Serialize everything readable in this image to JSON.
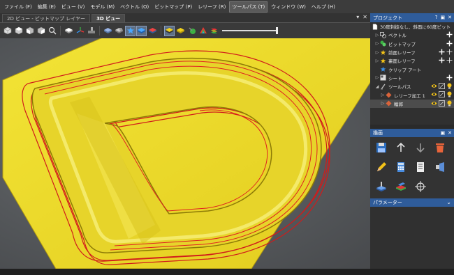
{
  "menu": [
    {
      "label": "ファイル (F)",
      "active": false
    },
    {
      "label": "編集 (E)",
      "active": false
    },
    {
      "label": "ビュー (V)",
      "active": false
    },
    {
      "label": "モデル (M)",
      "active": false
    },
    {
      "label": "ベクトル (O)",
      "active": false
    },
    {
      "label": "ビットマップ (P)",
      "active": false
    },
    {
      "label": "レリーフ (R)",
      "active": false
    },
    {
      "label": "ツールパス (T)",
      "active": true
    },
    {
      "label": "ウィンドウ (W)",
      "active": false
    },
    {
      "label": "ヘルプ (H)",
      "active": false
    }
  ],
  "tabs": [
    {
      "label": "2D ビュー - ビットマップ レイヤー",
      "active": false
    },
    {
      "label": "3D ビュー",
      "active": true
    }
  ],
  "tab_controls": {
    "pin": "▾",
    "close": "✕"
  },
  "project_panel": {
    "title": "プロジェクト",
    "controls": [
      "?",
      "▣",
      "✕"
    ],
    "tree": [
      {
        "label": "30度刺抜なし、斜面に60度ビット",
        "indent": 0,
        "arrow": "",
        "icon": "doc-icon",
        "highlight": false
      },
      {
        "label": "ベクトル",
        "indent": 1,
        "arrow": "▷",
        "icon": "vector-icon",
        "highlight": false
      },
      {
        "label": "ビットマップ",
        "indent": 1,
        "arrow": "▷",
        "icon": "bitmap-icon",
        "highlight": false
      },
      {
        "label": "前面レリーフ",
        "indent": 1,
        "arrow": "▷",
        "icon": "star-icon",
        "highlight": false
      },
      {
        "label": "裏面レリーフ",
        "indent": 1,
        "arrow": "▷",
        "icon": "star-icon",
        "highlight": false
      },
      {
        "label": "クリップ アート",
        "indent": 1,
        "arrow": "",
        "icon": "clipart-icon",
        "highlight": false
      },
      {
        "label": "シート",
        "indent": 1,
        "arrow": "▷",
        "icon": "sheet-icon",
        "highlight": false
      },
      {
        "label": "ツールパス",
        "indent": 1,
        "arrow": "◢",
        "icon": "toolpath-icon",
        "highlight": false
      },
      {
        "label": "レリーフ加工 1",
        "indent": 2,
        "arrow": "▷",
        "icon": "toolpath-item-icon",
        "highlight": false
      },
      {
        "label": "輪郭",
        "indent": 2,
        "arrow": "▷",
        "icon": "toolpath-item-icon",
        "highlight": true
      }
    ]
  },
  "draw_panel": {
    "title": "描画",
    "controls": [
      "▣",
      "✕"
    ],
    "buttons": [
      "save-icon",
      "arrow-up-icon",
      "arrow-down-icon",
      "trash-icon",
      "pencil-icon",
      "calculator-icon",
      "notes-icon",
      "simulate-icon",
      "machine-icon",
      "block-icon",
      "transform-icon"
    ]
  },
  "params_panel": {
    "title": "パラメーター",
    "chevron": "⌄"
  },
  "colors": {
    "accent": "#2f5c9a",
    "relief": "#e8d22a",
    "toolpath": "#d11b1b"
  }
}
